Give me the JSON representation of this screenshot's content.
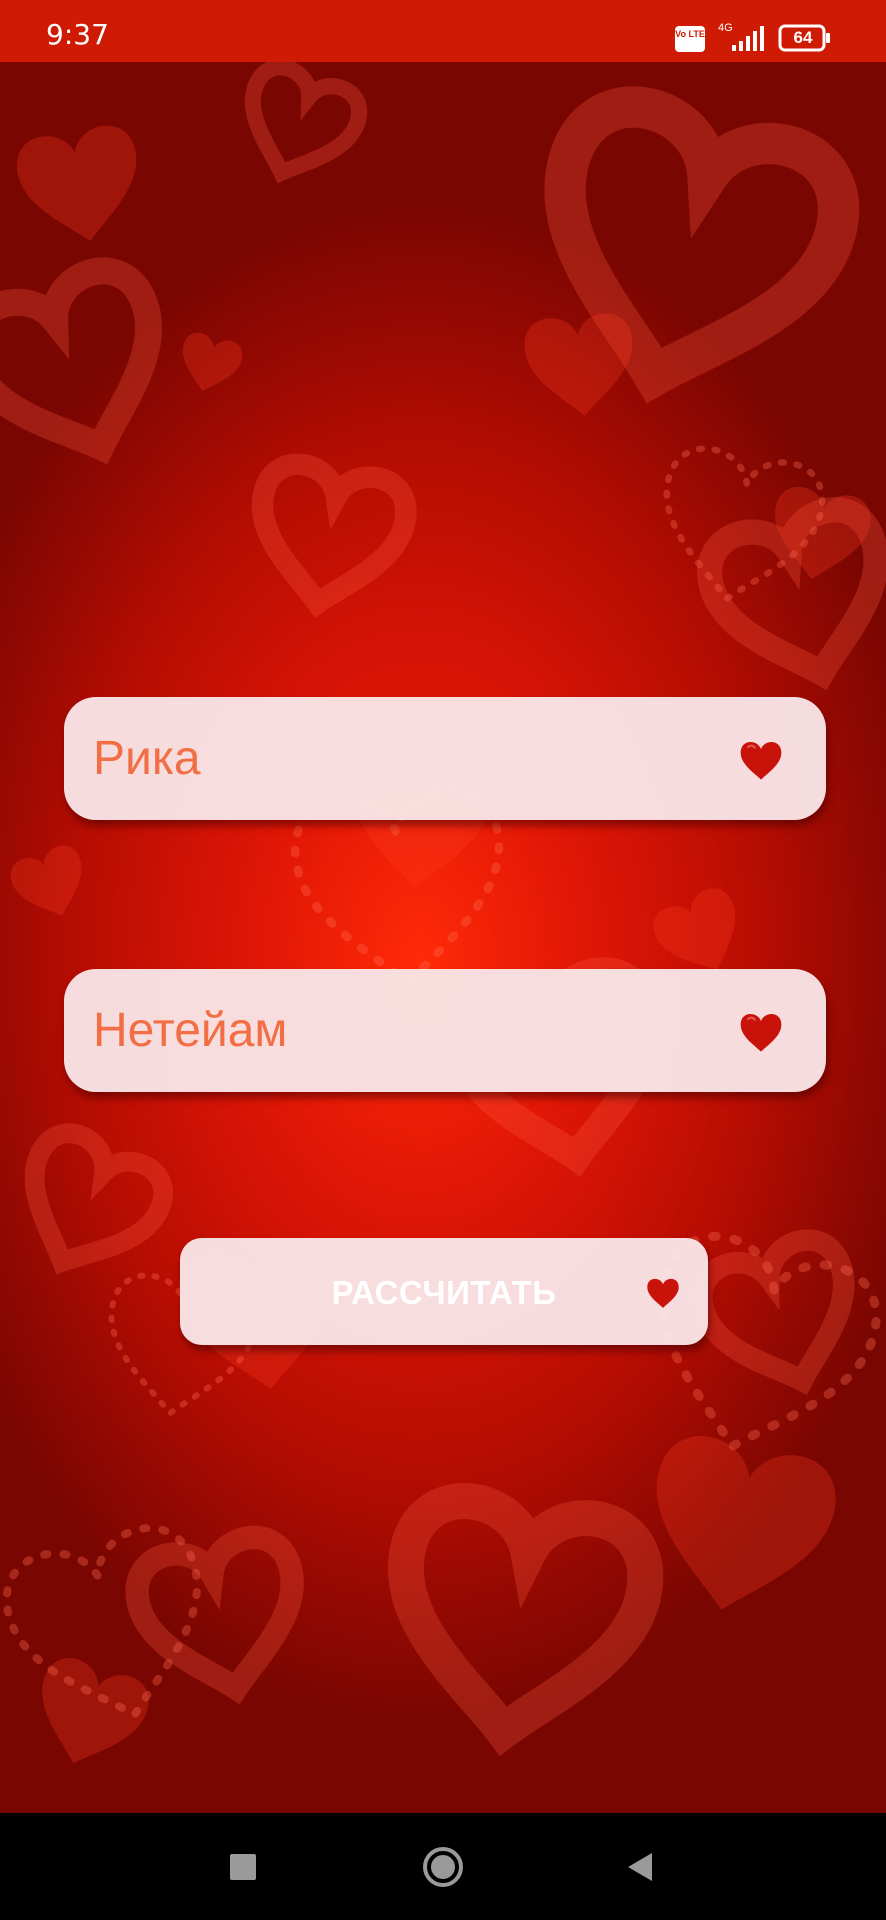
{
  "status_bar": {
    "time": "9:37",
    "volte_label": "Vo LTE",
    "network_label": "4G",
    "battery_level": "64",
    "background_color": "#cf1a04"
  },
  "form": {
    "first_name_value": "Рика",
    "second_name_value": "Нетейам",
    "text_color": "#f26f45",
    "heart_color": "#c8120a",
    "heart_icon": "heart-icon"
  },
  "action": {
    "calculate_label": "РАССЧИТАТЬ"
  },
  "nav_bar": {
    "recents_icon": "square-icon",
    "home_icon": "circle-icon",
    "back_icon": "triangle-back-icon"
  }
}
